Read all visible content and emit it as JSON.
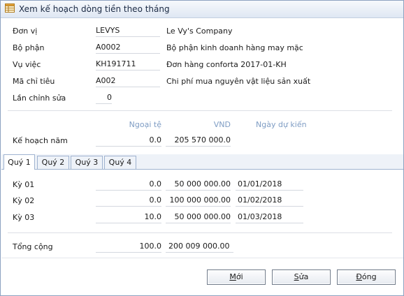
{
  "window": {
    "title": "Xem kế hoạch dòng tiền theo tháng"
  },
  "info": {
    "unit": {
      "label": "Đơn vị",
      "code": "LEVYS",
      "name": "Le Vy's Company"
    },
    "dept": {
      "label": "Bộ phận",
      "code": "A0002",
      "name": "Bộ phận kinh doanh hàng may mặc"
    },
    "job": {
      "label": "Vụ việc",
      "code": "KH191711",
      "name": "Đơn hàng conforta 2017-01-KH"
    },
    "target": {
      "label": "Mã chỉ tiêu",
      "code": "A002",
      "name": "Chi phí mua nguyên vật liệu sản xuất"
    },
    "revision": {
      "label": "Lần chỉnh sửa",
      "value": "0"
    }
  },
  "columns": {
    "foreign": "Ngoại tệ",
    "vnd": "VND",
    "expected_date": "Ngày dự kiến"
  },
  "annual_plan": {
    "label": "Kế hoạch năm",
    "foreign": "0.0",
    "vnd": "205 570 000.0"
  },
  "tabs": [
    "Quý 1",
    "Quý 2",
    "Quý 3",
    "Quý 4"
  ],
  "periods": [
    {
      "label": "Kỳ 01",
      "foreign": "0.0",
      "vnd": "50 000 000.00",
      "date": "01/01/2018"
    },
    {
      "label": "Kỳ 02",
      "foreign": "0.0",
      "vnd": "100 000 000.00",
      "date": "01/02/2018"
    },
    {
      "label": "Kỳ 03",
      "foreign": "10.0",
      "vnd": "50 000 000.00",
      "date": "01/03/2018"
    }
  ],
  "total": {
    "label": "Tổng cộng",
    "foreign": "100.0",
    "vnd": "200 009 000.00"
  },
  "buttons": {
    "new": {
      "pre": "",
      "key": "M",
      "post": "ới"
    },
    "edit": {
      "pre": "",
      "key": "S",
      "post": "ửa"
    },
    "close": {
      "pre": "",
      "key": "Đ",
      "post": "óng"
    }
  }
}
